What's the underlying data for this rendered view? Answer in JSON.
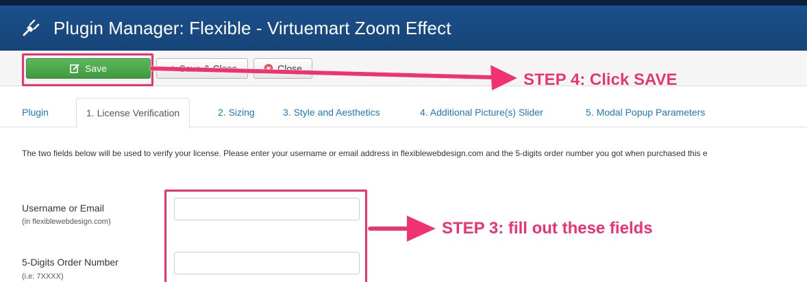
{
  "header": {
    "title": "Plugin Manager: Flexible - Virtuemart Zoom Effect",
    "icon": "plug-icon"
  },
  "toolbar": {
    "save_label": "Save",
    "save_close_label": "Save & Close",
    "close_label": "Close"
  },
  "tabs": [
    {
      "label": "Plugin",
      "active": false
    },
    {
      "label": "1. License Verification",
      "active": true
    },
    {
      "label": "2. Sizing",
      "active": false
    },
    {
      "label": "3. Style and Aesthetics",
      "active": false
    },
    {
      "label": "4. Additional Picture(s) Slider",
      "active": false
    },
    {
      "label": "5. Modal Popup Parameters",
      "active": false
    }
  ],
  "intro_text": "The two fields below will be used to verify your license. Please enter your username or email address in flexiblewebdesign.com and the 5-digits order number you got when purchased this e",
  "fields": [
    {
      "label": "Username or Email",
      "hint": "(in flexiblewebdesign.com)",
      "value": ""
    },
    {
      "label": "5-Digits Order Number",
      "hint": "(i.e: 7XXXX)",
      "value": ""
    }
  ],
  "annotations": {
    "step4": "STEP 4: Click SAVE",
    "step3": "STEP 3: fill out these fields",
    "color": "#f0316f"
  },
  "colors": {
    "header_bg": "#1c4f8c",
    "save_green": "#5cb85c",
    "link_blue": "#1a7ac0",
    "close_red": "#d9534f"
  }
}
